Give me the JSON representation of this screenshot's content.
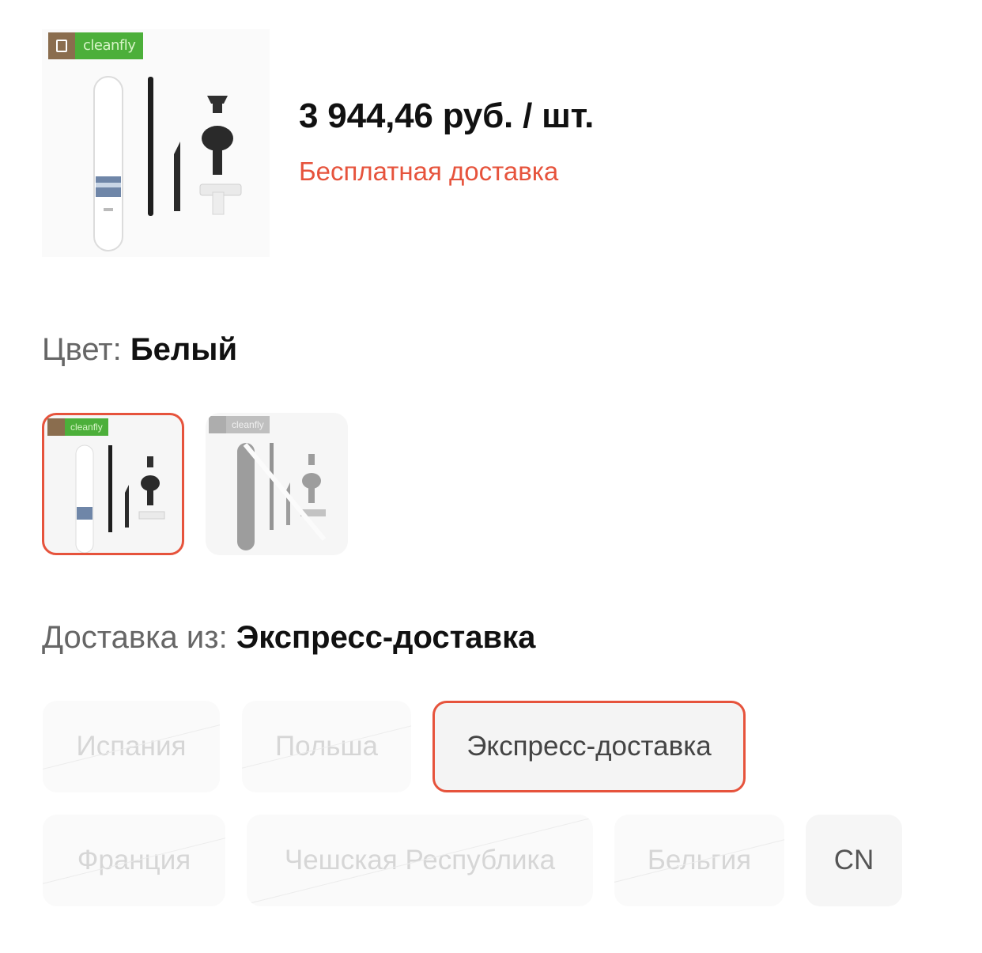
{
  "product": {
    "brand": "cleanfly",
    "price": "3 944,46 руб. / шт.",
    "shipping_note": "Бесплатная доставка"
  },
  "color_selector": {
    "label": "Цвет:",
    "selected_value": "Белый",
    "options": [
      {
        "brand": "cleanfly",
        "state": "selected"
      },
      {
        "brand": "cleanfly",
        "state": "disabled"
      }
    ]
  },
  "ship_from_selector": {
    "label": "Доставка из:",
    "selected_value": "Экспресс-доставка",
    "options": [
      {
        "label": "Испания",
        "state": "disabled"
      },
      {
        "label": "Польша",
        "state": "disabled"
      },
      {
        "label": "Экспресс-доставка",
        "state": "selected"
      },
      {
        "label": "Франция",
        "state": "disabled"
      },
      {
        "label": "Чешская Республика",
        "state": "disabled"
      },
      {
        "label": "Бельгия",
        "state": "disabled"
      },
      {
        "label": "CN",
        "state": "enabled"
      }
    ]
  },
  "colors": {
    "accent": "#e6533c",
    "price_text": "#111111",
    "label_text": "#666666",
    "chip_bg": "#f6f6f6"
  }
}
